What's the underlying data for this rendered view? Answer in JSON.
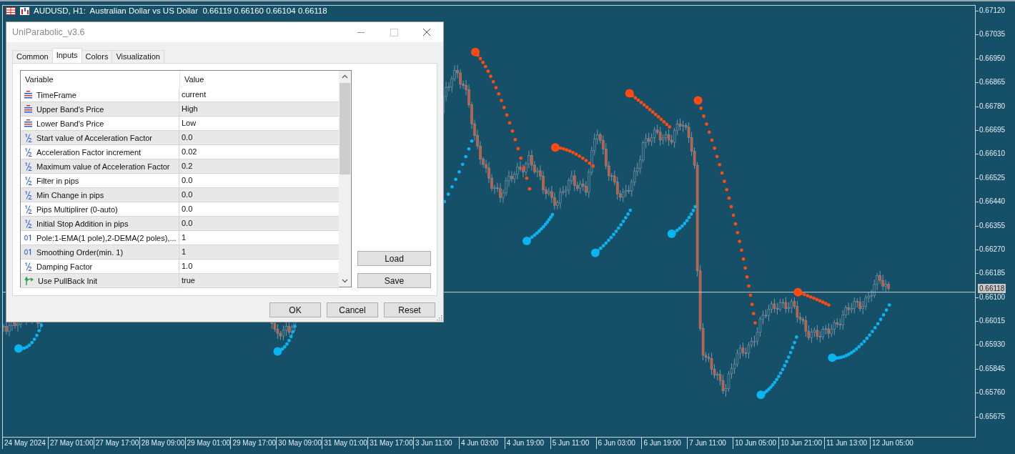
{
  "window": {
    "title": "AUDUSD, H1:  Australian Dollar vs US Dollar  0.66119 0.66160 0.66104 0.66118"
  },
  "chart": {
    "price_axis": [
      "0.67120",
      "0.67035",
      "0.66950",
      "0.66865",
      "0.66780",
      "0.66695",
      "0.66610",
      "0.66525",
      "0.66440",
      "0.66355",
      "0.66270",
      "0.66185",
      "0.66100",
      "0.66015",
      "0.65930",
      "0.65845",
      "0.65760",
      "0.65675"
    ],
    "current_price": "0.66118",
    "time_axis": [
      "24 May 2024",
      "27 May 01:00",
      "27 May 17:00",
      "28 May 09:00",
      "29 May 01:00",
      "29 May 17:00",
      "30 May 09:00",
      "31 May 01:00",
      "31 May 17:00",
      "3 Jun 11:00",
      "4 Jun 03:00",
      "4 Jun 19:00",
      "5 Jun 11:00",
      "6 Jun 03:00",
      "6 Jun 19:00",
      "7 Jun 11:00",
      "10 Jun 05:00",
      "10 Jun 21:00",
      "11 Jun 13:00",
      "12 Jun 05:00"
    ]
  },
  "dialog": {
    "title": "UniParabolic_v3.6",
    "tabs": [
      {
        "label": "Common",
        "selected": false
      },
      {
        "label": "Inputs",
        "selected": true
      },
      {
        "label": "Colors",
        "selected": false
      },
      {
        "label": "Visualization",
        "selected": false
      }
    ],
    "table": {
      "columns": [
        "Variable",
        "Value"
      ],
      "rows": [
        {
          "kind": "enum",
          "variable": "TimeFrame",
          "value": "current"
        },
        {
          "kind": "enum",
          "variable": "Upper Band's Price",
          "value": "High"
        },
        {
          "kind": "enum",
          "variable": "Lower Band's Price",
          "value": "Low"
        },
        {
          "kind": "double",
          "variable": "Start value of Acceleration Factor",
          "value": "0.0"
        },
        {
          "kind": "double",
          "variable": "Acceleration Factor increment",
          "value": "0.02"
        },
        {
          "kind": "double",
          "variable": "Maximum value of Acceleration Factor",
          "value": "0.2"
        },
        {
          "kind": "double",
          "variable": "Filter in pips",
          "value": "0.0"
        },
        {
          "kind": "double",
          "variable": "Min Change in pips",
          "value": "0.0"
        },
        {
          "kind": "double",
          "variable": "Pips Multiplirer (0-auto)",
          "value": "0.0"
        },
        {
          "kind": "double",
          "variable": "Initial Stop Addition in pips",
          "value": "0.0"
        },
        {
          "kind": "int",
          "variable": "Pole:1-EMA(1 pole),2-DEMA(2 poles),...",
          "value": "1"
        },
        {
          "kind": "int",
          "variable": "Smoothing Order(min. 1)",
          "value": "1"
        },
        {
          "kind": "double",
          "variable": "Damping Factor",
          "value": "1.0"
        },
        {
          "kind": "bool",
          "variable": "Use PullBack Init",
          "value": "true"
        }
      ]
    },
    "side_buttons": [
      "Load",
      "Save"
    ],
    "buttons": [
      "OK",
      "Cancel",
      "Reset"
    ]
  }
}
